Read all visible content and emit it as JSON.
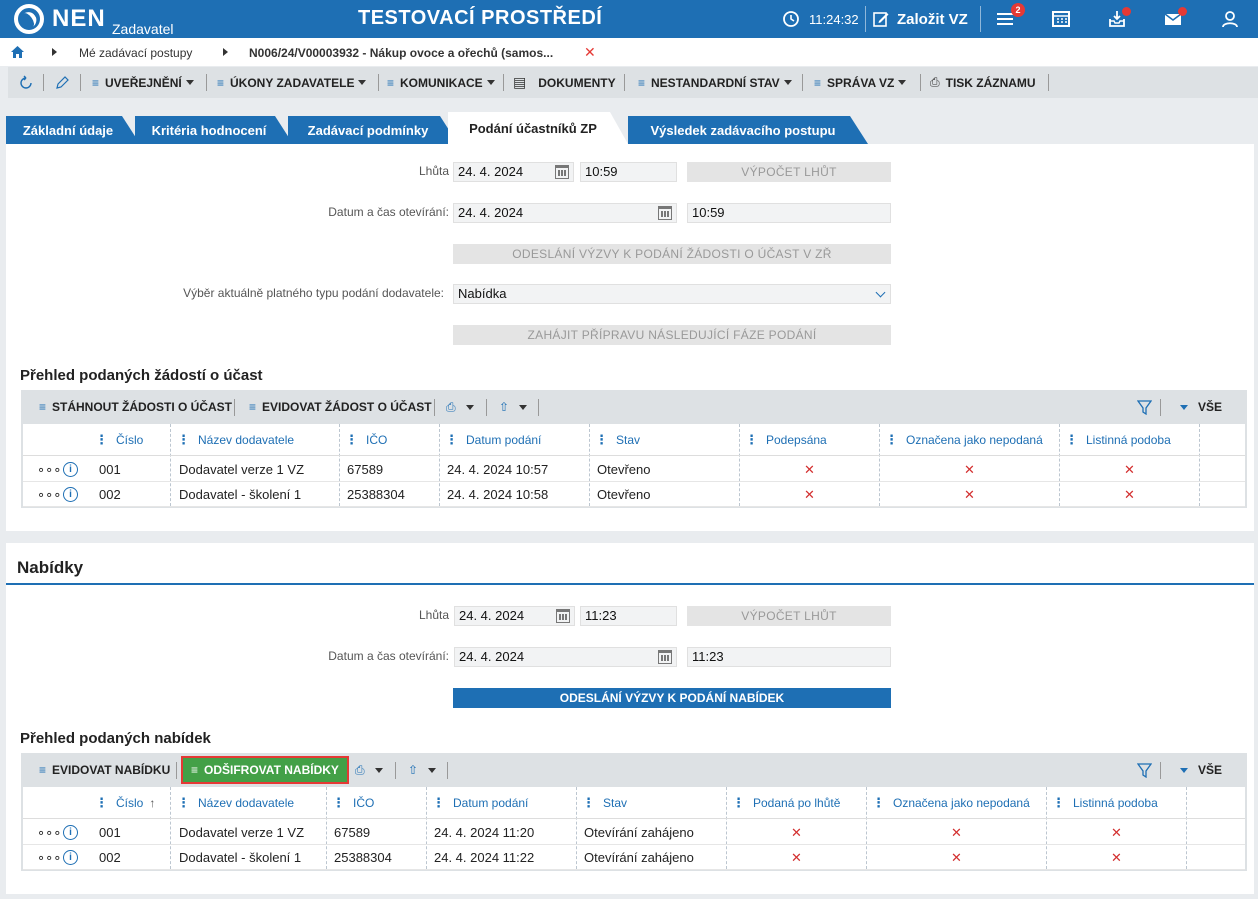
{
  "header": {
    "logo": "NEN",
    "logo_sub": "Zadavatel",
    "env_title": "TESTOVACÍ PROSTŘEDÍ",
    "clock": "11:24:32",
    "create_label": "Založit VZ",
    "menu_badge": "2"
  },
  "breadcrumb": {
    "item1": "Mé zadávací postupy",
    "item2": "N006/24/V00003932 - Nákup ovoce a ořechů (samos..."
  },
  "toolbar": {
    "uverejneni": "UVEŘEJNĚNÍ",
    "ukony": "ÚKONY ZADAVATELE",
    "komunikace": "KOMUNIKACE",
    "dokumenty": "DOKUMENTY",
    "nestandardni": "NESTANDARDNÍ STAV",
    "sprava": "SPRÁVA VZ",
    "tisk": "TISK ZÁZNAMU"
  },
  "tabs": [
    "Základní údaje",
    "Kritéria hodnocení",
    "Zadávací podmínky",
    "Podání účastníků ZP",
    "Výsledek zadávacího postupu"
  ],
  "zadosti": {
    "lhuta_label": "Lhůta",
    "lhuta_date": "24. 4. 2024",
    "lhuta_time": "10:59",
    "vypocet": "VÝPOČET LHŮT",
    "otevirani_label": "Datum a čas otevírání:",
    "otevirani_date": "24. 4. 2024",
    "otevirani_time": "10:59",
    "odeslani": "ODESLÁNÍ VÝZVY K PODÁNÍ ŽÁDOSTI O ÚČAST V ZŘ",
    "vyber_label": "Výběr aktuálně platného typu podání dodavatele:",
    "vyber_value": "Nabídka",
    "zahajit": "ZAHÁJIT PŘÍPRAVU NÁSLEDUJÍCÍ FÁZE PODÁNÍ",
    "title": "Přehled podaných žádostí o účast",
    "btn_stahnout": "STÁHNOUT ŽÁDOSTI O ÚČAST",
    "btn_evidovat": "EVIDOVAT ŽÁDOST O ÚČAST",
    "vse": "VŠE",
    "columns": [
      "Číslo",
      "Název dodavatele",
      "IČO",
      "Datum podání",
      "Stav",
      "Podepsána",
      "Označena jako nepodaná",
      "Listinná podoba"
    ],
    "rows": [
      {
        "cislo": "001",
        "nazev": "Dodavatel verze 1 VZ",
        "ico": "67589",
        "datum": "24. 4. 2024 10:57",
        "stav": "Otevřeno"
      },
      {
        "cislo": "002",
        "nazev": "Dodavatel - školení 1",
        "ico": "25388304",
        "datum": "24. 4. 2024 10:58",
        "stav": "Otevřeno"
      }
    ]
  },
  "nabidky": {
    "section_title": "Nabídky",
    "lhuta_label": "Lhůta",
    "lhuta_date": "24. 4. 2024",
    "lhuta_time": "11:23",
    "vypocet": "VÝPOČET LHŮT",
    "otevirani_label": "Datum a čas otevírání:",
    "otevirani_date": "24. 4. 2024",
    "otevirani_time": "11:23",
    "odeslani": "ODESLÁNÍ VÝZVY K PODÁNÍ NABÍDEK",
    "title": "Přehled podaných nabídek",
    "btn_evidovat": "EVIDOVAT NABÍDKU",
    "btn_odsifrovat": "ODŠIFROVAT NABÍDKY",
    "vse": "VŠE",
    "columns": [
      "Číslo",
      "Název dodavatele",
      "IČO",
      "Datum podání",
      "Stav",
      "Podaná po lhůtě",
      "Označena jako nepodaná",
      "Listinná podoba"
    ],
    "rows": [
      {
        "cislo": "001",
        "nazev": "Dodavatel verze 1 VZ",
        "ico": "67589",
        "datum": "24. 4. 2024 11:20",
        "stav": "Otevírání zahájeno"
      },
      {
        "cislo": "002",
        "nazev": "Dodavatel - školení 1",
        "ico": "25388304",
        "datum": "24. 4. 2024 11:22",
        "stav": "Otevírání zahájeno"
      }
    ]
  },
  "symbols": {
    "x": "✕",
    "more": "∘∘∘",
    "info": "i",
    "sort_up": "↑"
  }
}
